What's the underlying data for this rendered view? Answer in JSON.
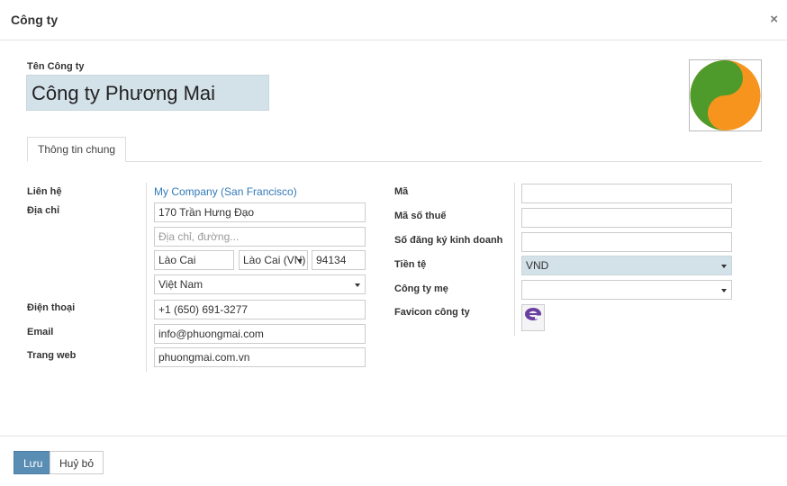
{
  "dialog": {
    "title": "Công ty",
    "close_symbol": "×"
  },
  "company": {
    "name_label": "Tên Công ty",
    "name": "Công ty Phương Mai"
  },
  "tabs": [
    {
      "label": "Thông tin chung"
    }
  ],
  "left": {
    "contact_label": "Liên hệ",
    "contact_value": "My Company (San Francisco)",
    "address_label": "Địa chỉ",
    "street": "170 Trần Hưng Đạo",
    "street2_placeholder": "Địa chỉ, đường...",
    "city": "Lào Cai",
    "state": "Lào Cai (VN)",
    "zip": "94134",
    "country": "Việt Nam",
    "phone_label": "Điện thoại",
    "phone": "+1 (650) 691-3277",
    "email_label": "Email",
    "email": "info@phuongmai.com",
    "website_label": "Trang web",
    "website": "phuongmai.com.vn"
  },
  "right": {
    "code_label": "Mã",
    "code": "",
    "tax_label": "Mã số thuế",
    "tax": "",
    "reg_label": "Số đăng ký kinh doanh",
    "reg": "",
    "currency_label": "Tiền tệ",
    "currency": "VND",
    "parent_label": "Công ty mẹ",
    "parent": "",
    "favicon_label": "Favicon công ty"
  },
  "footer": {
    "save_label": "Lưu",
    "cancel_label": "Huỷ bỏ"
  },
  "colors": {
    "accent": "#5a8db3",
    "highlight": "#d3e1e9",
    "link": "#337ab7",
    "logo_green": "#4e9a2a",
    "logo_orange": "#f7941d"
  },
  "icons": {
    "logo": "company-logo-yin-yang",
    "favicon": "favicon-e-icon"
  }
}
